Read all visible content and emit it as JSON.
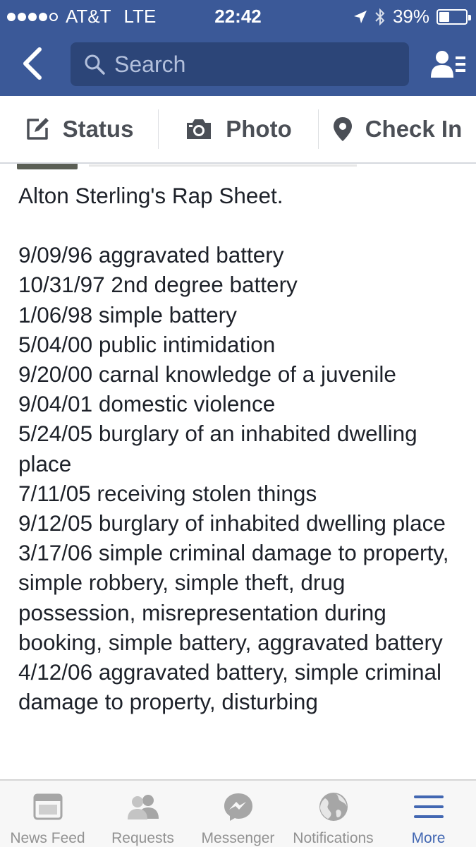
{
  "status_bar": {
    "carrier": "AT&T",
    "network": "LTE",
    "time": "22:42",
    "battery_percent": "39%",
    "battery_level": 0.39,
    "signal_bars_filled": 4,
    "signal_bars_total": 5
  },
  "nav": {
    "search_placeholder": "Search"
  },
  "composer": {
    "status_label": "Status",
    "photo_label": "Photo",
    "checkin_label": "Check In"
  },
  "post": {
    "title": "Alton Sterling's Rap Sheet.",
    "entries": [
      "9/09/96 aggravated battery",
      "10/31/97 2nd degree battery",
      "1/06/98 simple battery",
      "5/04/00 public intimidation",
      "9/20/00 carnal knowledge of a juvenile",
      "9/04/01 domestic violence",
      "5/24/05 burglary of an inhabited dwelling place",
      "7/11/05 receiving stolen things",
      "9/12/05 burglary of inhabited dwelling place",
      "3/17/06 simple criminal damage to property, simple robbery, simple theft, drug possession, misrepresentation during booking, simple battery, aggravated battery",
      "4/12/06 aggravated battery, simple criminal damage to property, disturbing"
    ]
  },
  "tabs": [
    {
      "label": "News Feed",
      "icon": "news-feed-icon",
      "active": false
    },
    {
      "label": "Requests",
      "icon": "requests-icon",
      "active": false
    },
    {
      "label": "Messenger",
      "icon": "messenger-icon",
      "active": false
    },
    {
      "label": "Notifications",
      "icon": "globe-icon",
      "active": false
    },
    {
      "label": "More",
      "icon": "menu-icon",
      "active": true
    }
  ],
  "colors": {
    "brand_blue": "#3b5998",
    "active_tab": "#4267b2",
    "inactive_tab": "#929292"
  }
}
